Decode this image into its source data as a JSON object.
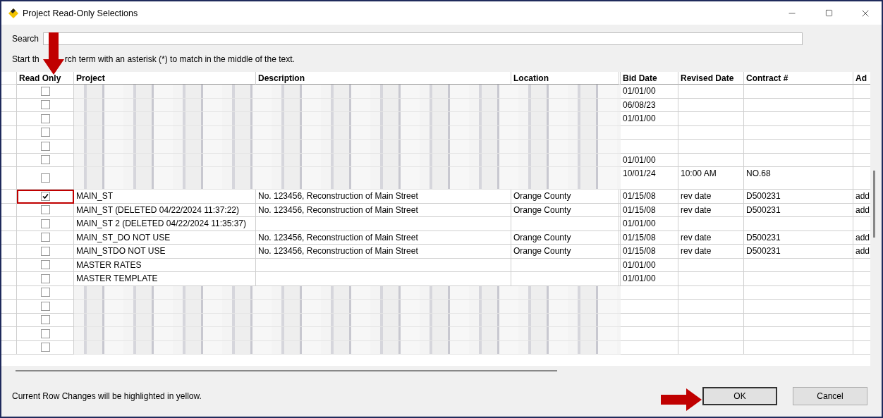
{
  "window": {
    "title": "Project Read-Only Selections"
  },
  "search": {
    "label": "Search"
  },
  "help_text": {
    "before": "Start th",
    "after": "rch term with an asterisk (*) to match in the middle of the text."
  },
  "table": {
    "columns": [
      "Read Only",
      "Project",
      "Description",
      "Location",
      "Bid Date",
      "Revised Date",
      "Contract #",
      "Ad"
    ],
    "rows": [
      {
        "kind": "redacted",
        "checked": false,
        "highlighted": false,
        "bid_date": "01/01/00",
        "revised_date": "",
        "contract": "",
        "column_8": ""
      },
      {
        "kind": "redacted",
        "checked": false,
        "highlighted": false,
        "bid_date": "06/08/23",
        "revised_date": "",
        "contract": "",
        "column_8": ""
      },
      {
        "kind": "redacted",
        "checked": false,
        "highlighted": false,
        "bid_date": "01/01/00",
        "revised_date": "",
        "contract": "",
        "column_8": ""
      },
      {
        "kind": "redacted",
        "checked": false,
        "highlighted": false,
        "bid_date": "",
        "revised_date": "",
        "contract": "",
        "column_8": ""
      },
      {
        "kind": "redacted",
        "checked": false,
        "highlighted": false,
        "bid_date": "",
        "revised_date": "",
        "contract": "",
        "column_8": ""
      },
      {
        "kind": "redacted",
        "checked": false,
        "highlighted": false,
        "bid_date": "01/01/00",
        "revised_date": "",
        "contract": "",
        "column_8": ""
      },
      {
        "kind": "redacted",
        "checked": false,
        "highlighted": false,
        "bid_date": "10/01/24",
        "revised_date": "10:00 AM",
        "contract": "NO.68",
        "column_8": ""
      },
      {
        "kind": "plain",
        "checked": true,
        "highlighted": true,
        "project": "MAIN_ST",
        "description": "No. 123456, Reconstruction of Main Street",
        "location": "Orange County",
        "bid_date": "01/15/08",
        "revised_date": "rev date",
        "contract": "D500231",
        "column_8": "add"
      },
      {
        "kind": "plain",
        "checked": false,
        "highlighted": false,
        "project": "MAIN_ST (DELETED 04/22/2024 11:37:22)",
        "description": "No. 123456, Reconstruction of Main Street",
        "location": "Orange County",
        "bid_date": "01/15/08",
        "revised_date": "rev date",
        "contract": "D500231",
        "column_8": "add"
      },
      {
        "kind": "plain",
        "checked": false,
        "highlighted": false,
        "project": "MAIN_ST 2 (DELETED 04/22/2024 11:35:37)",
        "description": "",
        "location": "",
        "bid_date": "01/01/00",
        "revised_date": "",
        "contract": "",
        "column_8": ""
      },
      {
        "kind": "plain",
        "checked": false,
        "highlighted": false,
        "project": "MAIN_ST_DO NOT USE",
        "description": "No. 123456, Reconstruction of Main Street",
        "location": "Orange County",
        "bid_date": "01/15/08",
        "revised_date": "rev date",
        "contract": "D500231",
        "column_8": "add"
      },
      {
        "kind": "plain",
        "checked": false,
        "highlighted": false,
        "project": "MAIN_STDO NOT USE",
        "description": "No. 123456, Reconstruction of Main Street",
        "location": "Orange County",
        "bid_date": "01/15/08",
        "revised_date": "rev date",
        "contract": "D500231",
        "column_8": "add"
      },
      {
        "kind": "plain",
        "checked": false,
        "highlighted": false,
        "project": "MASTER RATES",
        "description": "",
        "location": "",
        "bid_date": "01/01/00",
        "revised_date": "",
        "contract": "",
        "column_8": ""
      },
      {
        "kind": "plain",
        "checked": false,
        "highlighted": false,
        "project": "MASTER TEMPLATE",
        "description": "",
        "location": "",
        "bid_date": "01/01/00",
        "revised_date": "",
        "contract": "",
        "column_8": ""
      },
      {
        "kind": "redacted",
        "checked": false,
        "highlighted": false,
        "bid_date": "",
        "revised_date": "",
        "contract": "",
        "column_8": ""
      },
      {
        "kind": "redacted",
        "checked": false,
        "highlighted": false,
        "bid_date": "",
        "revised_date": "",
        "contract": "",
        "column_8": ""
      },
      {
        "kind": "redacted",
        "checked": false,
        "highlighted": false,
        "bid_date": "",
        "revised_date": "",
        "contract": "",
        "column_8": ""
      },
      {
        "kind": "redacted",
        "checked": false,
        "highlighted": false,
        "bid_date": "",
        "revised_date": "",
        "contract": "",
        "column_8": ""
      },
      {
        "kind": "redacted",
        "checked": false,
        "highlighted": false,
        "bid_date": "",
        "revised_date": "",
        "contract": "",
        "column_8": ""
      }
    ]
  },
  "status_text": "Current Row Changes will be highlighted in yellow.",
  "buttons": [
    {
      "label": "OK",
      "default": true
    },
    {
      "label": "Cancel",
      "default": false
    }
  ]
}
